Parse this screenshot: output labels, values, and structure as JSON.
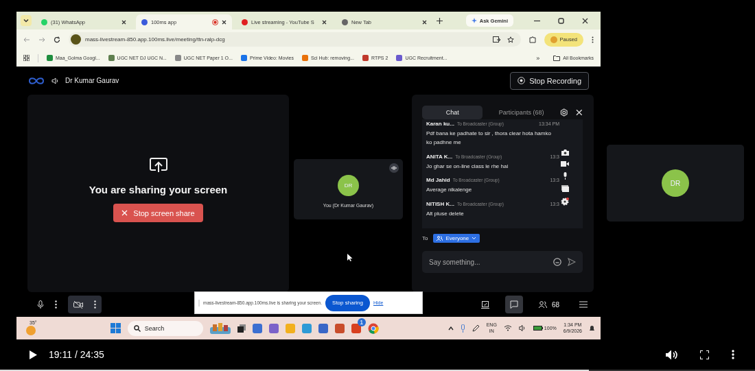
{
  "browser": {
    "tabs": [
      {
        "label": "(31) WhatsApp",
        "selected": false,
        "recording": false
      },
      {
        "label": "100ms app",
        "selected": true,
        "recording": true
      },
      {
        "label": "Live streaming - YouTube S",
        "selected": false,
        "recording": false
      },
      {
        "label": "New Tab",
        "selected": false,
        "recording": false
      }
    ],
    "ask_gemini": "Ask Gemini",
    "url": "mass-livestream-850.app.100ms.live/meeting/ttn-ralp-dcg",
    "profile": "Paused",
    "bookmarks": [
      "Maa_Golma  Googl...",
      "UGC NET DJ UGC N...",
      "UGC NET Paper 1 O...",
      "Prime Video: Movies",
      "Sci Hub: removing...",
      "RTPS 2",
      "UGC  Recruitment..."
    ],
    "more": "»",
    "all_bookmarks": "All Bookmarks"
  },
  "meeting": {
    "host": "Dr Kumar Gaurav",
    "record_button": "Stop Recording",
    "share_message": "You are sharing your screen",
    "stop_share_button": "Stop screen share",
    "self_tile": {
      "initials": "DR",
      "name": "You (Dr Kumar Gaurav)"
    },
    "chat": {
      "tabs": [
        {
          "label": "Chat",
          "selected": true
        },
        {
          "label": "Participants (68)",
          "selected": false
        }
      ],
      "messages": [
        {
          "sender": "Karan ku...",
          "recipient": "To Broadcaster (Group)",
          "time": "13:34 PM",
          "text": "Pdf bana ke padhate to sir ,  thora clear hota hamko ko padhne me"
        },
        {
          "sender": "ANITA K...",
          "recipient": "To Broadcaster (Group)",
          "time": "13:3",
          "text": "Jo ghar se on-line class le rhe hai"
        },
        {
          "sender": "Md Jahid",
          "recipient": "To Broadcaster (Group)",
          "time": "13:3",
          "text": "Average nikalenge"
        },
        {
          "sender": "NITISH K...",
          "recipient": "To Broadcaster (Group)",
          "time": "13:3",
          "text": "Alt pluse delete"
        }
      ],
      "to_label": "To",
      "audience": "Everyone",
      "placeholder": "Say something..."
    },
    "controls": {
      "mic_on": true,
      "camera_on": false,
      "chat_open": true,
      "participants": "68"
    }
  },
  "share_bar": {
    "text": "mass-livestream-850.app.100ms.live is sharing your screen.",
    "stop_button": "Stop sharing",
    "hide_link": "Hide"
  },
  "taskbar": {
    "temperature": "35°",
    "search": "Search",
    "badge": "1",
    "language": "ENG",
    "region": "IN",
    "battery": "100%",
    "time": "1:34 PM",
    "date": "6/9/2026"
  },
  "side_tile": {
    "initials": "DR"
  },
  "player": {
    "time": "19:11 / 24:35",
    "level": 0.78
  }
}
